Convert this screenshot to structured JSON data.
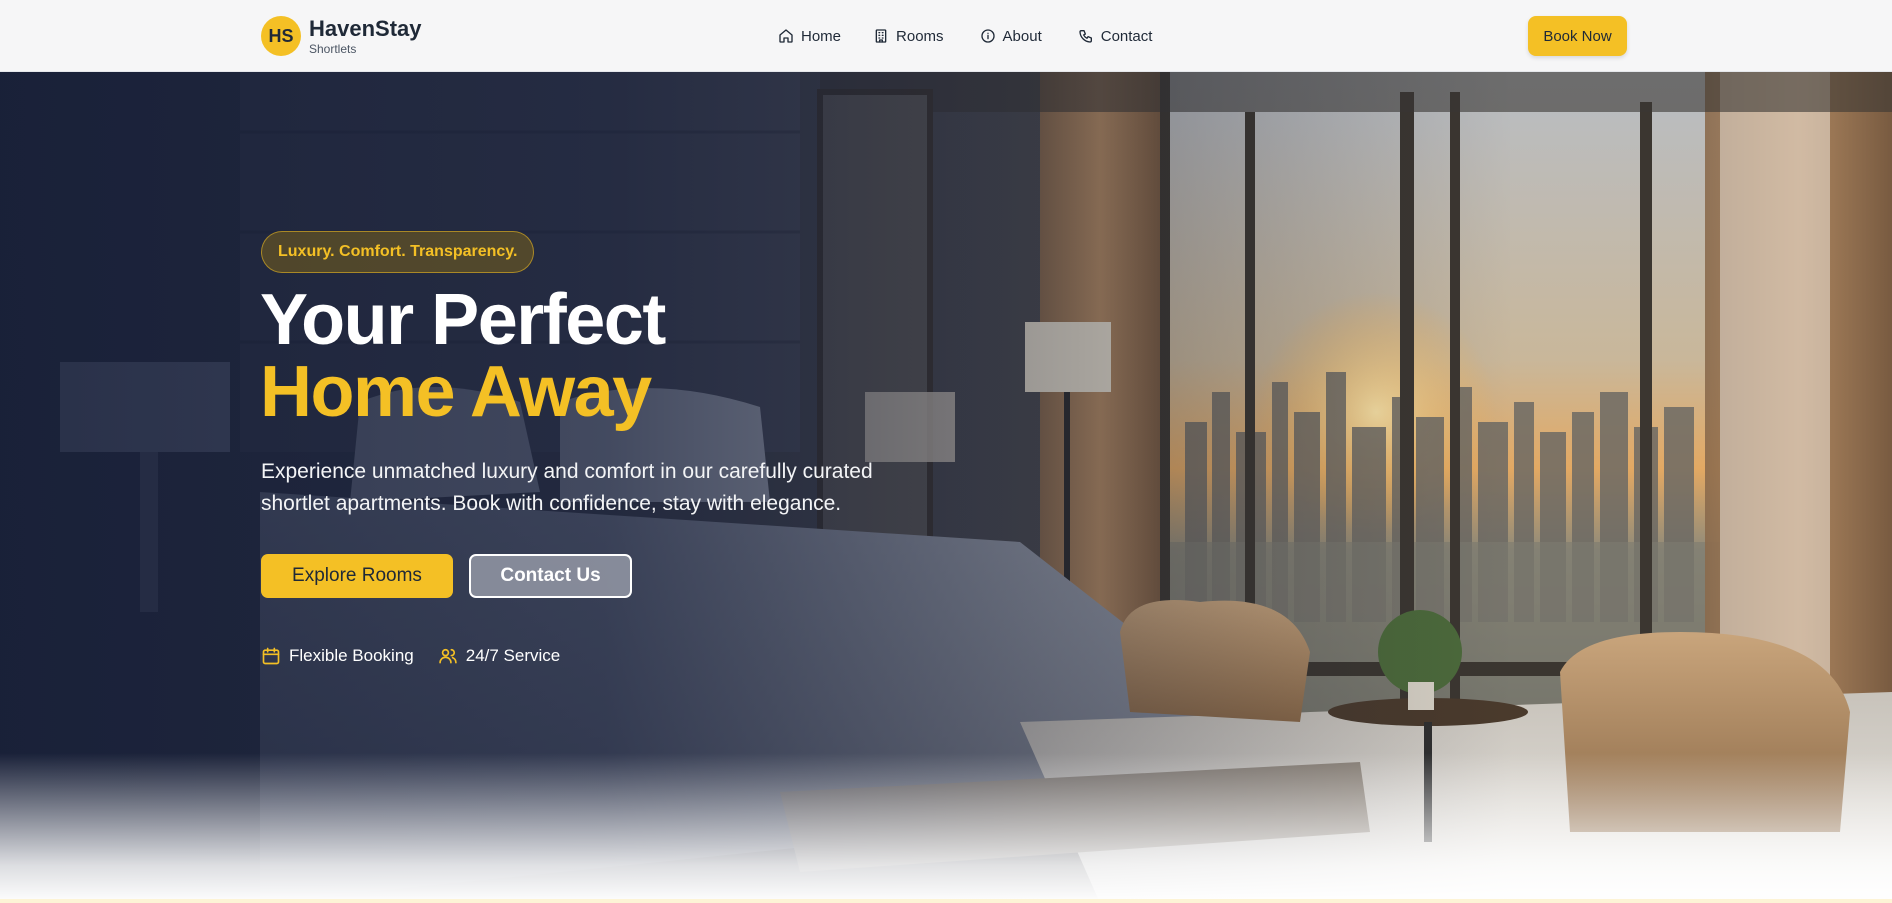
{
  "brand": {
    "badge": "HS",
    "name": "HavenStay",
    "subtitle": "Shortlets"
  },
  "nav": {
    "items": [
      {
        "label": "Home",
        "icon": "home-icon"
      },
      {
        "label": "Rooms",
        "icon": "building-icon"
      },
      {
        "label": "About",
        "icon": "info-icon"
      },
      {
        "label": "Contact",
        "icon": "phone-icon"
      }
    ],
    "cta_label": "Book Now"
  },
  "hero": {
    "tagline": "Luxury. Comfort. Transparency.",
    "title_line1": "Your Perfect",
    "title_line2": "Home Away",
    "description": "Experience unmatched luxury and comfort in our carefully curated shortlet apartments. Book with confidence, stay with elegance.",
    "primary_button": "Explore Rooms",
    "secondary_button": "Contact Us",
    "features": [
      {
        "label": "Flexible Booking",
        "icon": "calendar-icon"
      },
      {
        "label": "24/7 Service",
        "icon": "users-icon"
      }
    ]
  },
  "colors": {
    "accent": "#f4c025",
    "navbar_bg": "#f6f6f7",
    "text_dark": "#1f2937",
    "overlay": "#121a34"
  }
}
